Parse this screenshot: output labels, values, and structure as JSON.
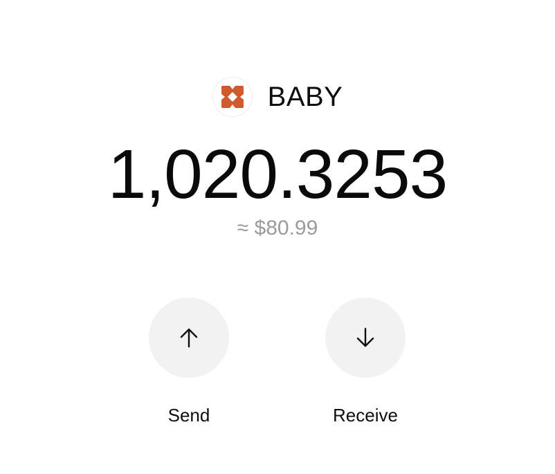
{
  "token": {
    "symbol": "BABY",
    "logo_icon": "baby-token-logo-icon",
    "brand_color": "#cf5a2c"
  },
  "balance": {
    "amount": "1,020.3253",
    "fiat_value": "≈ $80.99"
  },
  "actions": [
    {
      "label": "Send",
      "icon": "arrow-up-icon"
    },
    {
      "label": "Receive",
      "icon": "arrow-down-icon"
    }
  ]
}
